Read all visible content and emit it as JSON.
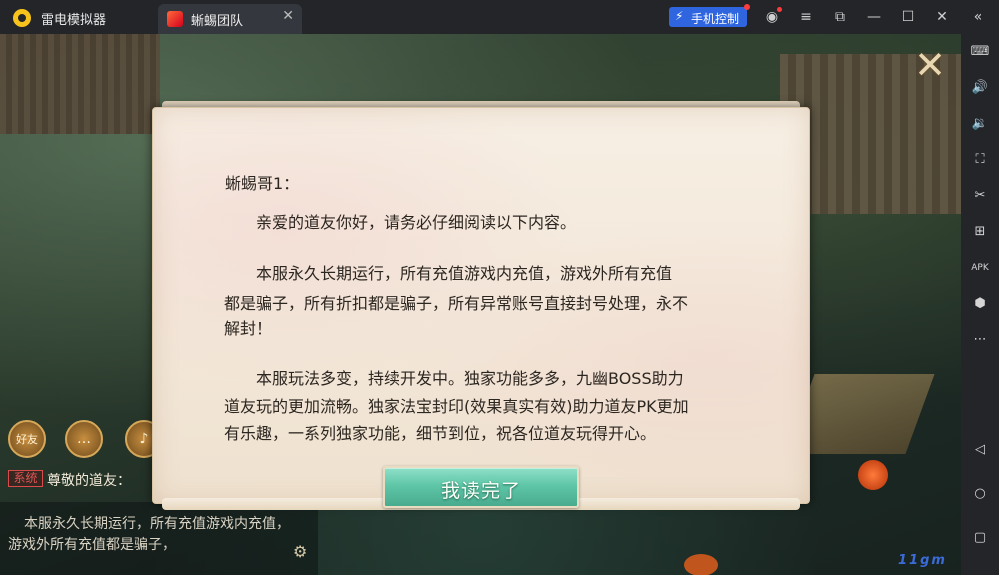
{
  "app": {
    "title": "雷电模拟器"
  },
  "tab": {
    "label": "蜥蜴团队"
  },
  "toolbar": {
    "phone_control": "手机控制"
  },
  "scroll": {
    "greeting": "蜥蜴哥1：",
    "lines": [
      "亲爱的道友你好，请务必仔细阅读以下内容。",
      "本服永久长期运行，所有充值游戏内充值，游戏外所有充值",
      "都是骗子，所有折扣都是骗子，所有异常账号直接封号处理，永不",
      "解封！",
      "本服玩法多变，持续开发中。独家功能多多，九幽BOSS助力",
      "道友玩的更加流畅。独家法宝封印(效果真实有效)助力道友PK更加",
      "有乐趣，一系列独家功能，细节到位，祝各位道友玩得开心。"
    ],
    "button_label": "我读完了"
  },
  "chat": {
    "friend_label": "好友",
    "system_tag": "系统",
    "system_text": "尊敬的道友：",
    "message": "本服永久长期运行，所有充值游戏内充值，游戏外所有充值都是骗子，"
  },
  "watermark": "11gm"
}
